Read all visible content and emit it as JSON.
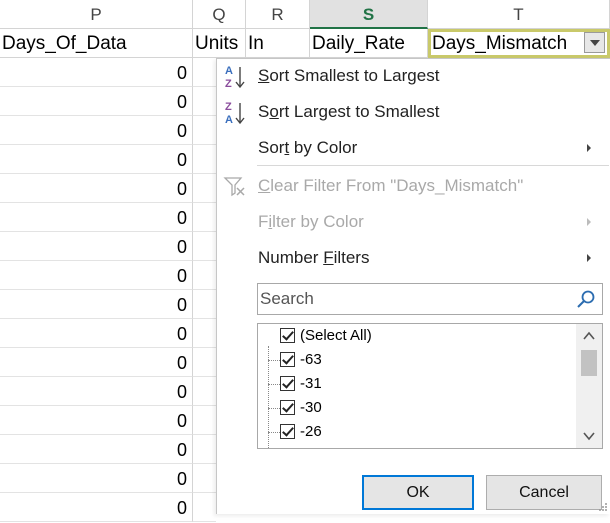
{
  "columns": [
    {
      "letter": "P",
      "header": "Days_Of_Data"
    },
    {
      "letter": "Q",
      "header": "Units"
    },
    {
      "letter": "R",
      "header": "In"
    },
    {
      "letter": "S",
      "header": "Daily_Rate"
    },
    {
      "letter": "T",
      "header": "Days_Mismatch"
    }
  ],
  "rows": [
    "0",
    "0",
    "0",
    "0",
    "0",
    "0",
    "0",
    "0",
    "0",
    "0",
    "0",
    "0",
    "0",
    "0",
    "0",
    "0"
  ],
  "menu": {
    "sort_asc": {
      "pre": "",
      "u": "S",
      "post": "ort Smallest to Largest"
    },
    "sort_desc": {
      "pre": "S",
      "u": "o",
      "post": "rt Largest to Smallest"
    },
    "sort_color": {
      "pre": "Sor",
      "u": "t",
      "post": " by Color"
    },
    "clear_filter": {
      "pre": "",
      "u": "C",
      "post": "lear Filter From \"Days_Mismatch\""
    },
    "filter_color": {
      "pre": "F",
      "u": "i",
      "post": "lter by Color"
    },
    "number_filters": {
      "pre": "Number ",
      "u": "F",
      "post": "ilters"
    },
    "az_top": "A",
    "az_bottom": "Z",
    "za_top": "Z",
    "za_bottom": "A"
  },
  "search": {
    "placeholder": "Search"
  },
  "values": [
    "(Select All)",
    "-63",
    "-31",
    "-30",
    "-26"
  ],
  "buttons": {
    "ok": "OK",
    "cancel": "Cancel"
  },
  "colors": {
    "accent_green": "#217346",
    "active_border": "#c9c96a",
    "ok_border": "#0078d7"
  }
}
